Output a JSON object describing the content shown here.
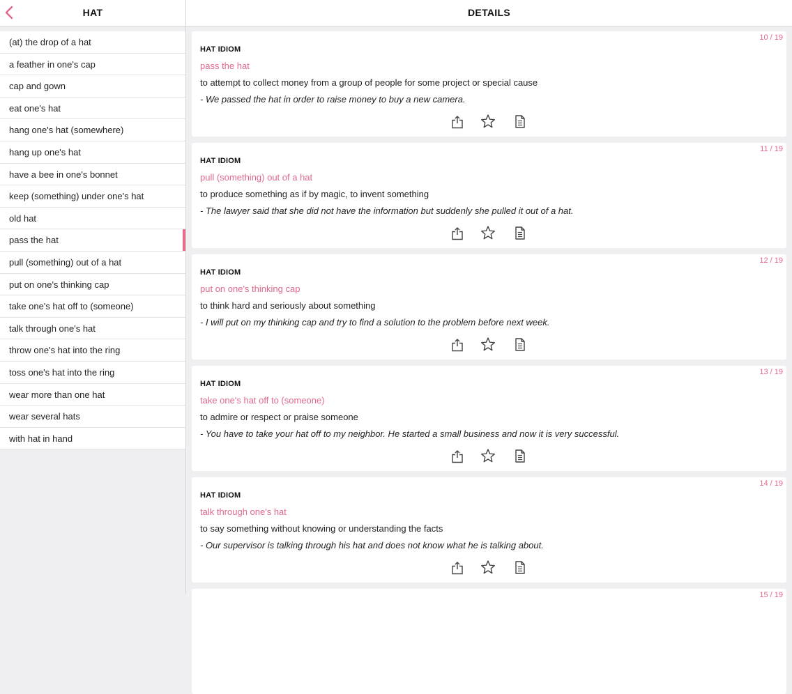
{
  "left_panel": {
    "title": "HAT",
    "back_icon": "chevron-left-icon",
    "items": [
      {
        "label": "(at) the drop of a hat"
      },
      {
        "label": "a feather in one's cap"
      },
      {
        "label": "cap and gown"
      },
      {
        "label": "eat one's hat"
      },
      {
        "label": "hang one's hat (somewhere)"
      },
      {
        "label": "hang up one's hat"
      },
      {
        "label": "have a bee in one's bonnet"
      },
      {
        "label": "keep (something) under one's hat"
      },
      {
        "label": "old hat"
      },
      {
        "label": "pass the hat",
        "active": true
      },
      {
        "label": "pull (something) out of a hat"
      },
      {
        "label": "put on one's thinking cap"
      },
      {
        "label": "take one's hat off to (someone)"
      },
      {
        "label": "talk through one's hat"
      },
      {
        "label": "throw one's hat into the ring"
      },
      {
        "label": "toss one's hat into the ring"
      },
      {
        "label": "wear more than one hat"
      },
      {
        "label": "wear several hats"
      },
      {
        "label": "with hat in hand"
      }
    ]
  },
  "right_panel": {
    "title": "DETAILS",
    "cards": [
      {
        "counter": "10 / 19",
        "category": "HAT IDIOM",
        "phrase": "pass the hat",
        "meaning": "to attempt to collect money from a group of people for some project or special cause",
        "example": "- We passed the hat in order to raise money to buy a new camera."
      },
      {
        "counter": "11 / 19",
        "category": "HAT IDIOM",
        "phrase": "pull (something) out of a hat",
        "meaning": "to produce something as if by magic, to invent something",
        "example": "- The lawyer said that she did not have the information but suddenly she pulled it out of a hat."
      },
      {
        "counter": "12 / 19",
        "category": "HAT IDIOM",
        "phrase": "put on one's thinking cap",
        "meaning": "to think hard and seriously about something",
        "example": "- I will put on my thinking cap and try to find a solution to the problem before next week."
      },
      {
        "counter": "13 / 19",
        "category": "HAT IDIOM",
        "phrase": "take one's hat off to (someone)",
        "meaning": "to admire or respect or praise someone",
        "example": "- You have to take your hat off to my neighbor. He started a small business and now it is very successful."
      },
      {
        "counter": "14 / 19",
        "category": "HAT IDIOM",
        "phrase": "talk through one's hat",
        "meaning": "to say something without knowing or understanding the facts",
        "example": "- Our supervisor is talking through his hat and does not know what he is talking about."
      },
      {
        "counter": "15 / 19"
      }
    ],
    "action_icons": [
      "share-icon",
      "star-icon",
      "note-icon"
    ]
  },
  "colors": {
    "accent": "#e0698a",
    "background": "#efeff1",
    "card": "#ffffff"
  }
}
